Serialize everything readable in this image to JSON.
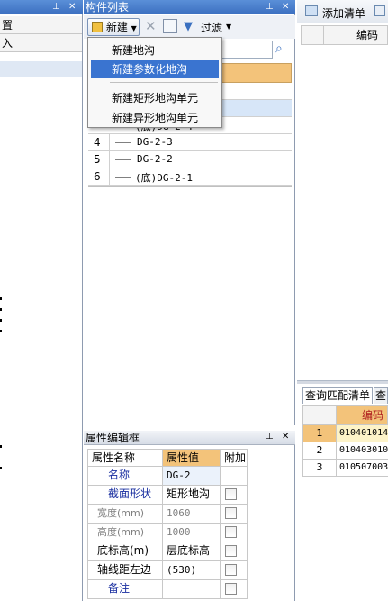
{
  "left_panel": {
    "item_1": "置",
    "item_2": "入"
  },
  "component_list": {
    "title": "构件列表",
    "new_button": "新建",
    "filter_button": "过滤",
    "rows": [
      {
        "num": "4",
        "name": "DG-2-3"
      },
      {
        "num": "5",
        "name": "DG-2-2"
      },
      {
        "num": "6",
        "name": "(底)DG-2-1"
      }
    ],
    "partial_row_name": "(底)DG-2-4"
  },
  "new_menu": {
    "items": [
      "新建地沟",
      "新建参数化地沟",
      "新建矩形地沟单元",
      "新建异形地沟单元"
    ],
    "highlighted_index": 1
  },
  "property_editor": {
    "title": "属性编辑框",
    "headers": {
      "name": "属性名称",
      "value": "属性值",
      "extra": "附加"
    },
    "rows": [
      {
        "name": "名称",
        "value": "DG-2",
        "style": "blue",
        "checkbox": false
      },
      {
        "name": "截面形状",
        "value": "矩形地沟",
        "style": "blue",
        "checkbox": true
      },
      {
        "name": "宽度(mm)",
        "value": "1060",
        "style": "gray",
        "checkbox": true
      },
      {
        "name": "高度(mm)",
        "value": "1000",
        "style": "gray",
        "checkbox": true
      },
      {
        "name": "底标高(m)",
        "value": "层底标高",
        "style": "black",
        "checkbox": true
      },
      {
        "name": "轴线距左边",
        "value": "(530)",
        "style": "black",
        "checkbox": true
      },
      {
        "name": "备注",
        "value": "",
        "style": "blue",
        "checkbox": true
      }
    ]
  },
  "bill_panel": {
    "add_button": "添加清单",
    "code_header": "编码",
    "tab_1": "查询匹配清单",
    "tab_2": "查",
    "match_code_header": "编码",
    "match_rows": [
      {
        "num": "1",
        "code": "010401014"
      },
      {
        "num": "2",
        "code": "010403010"
      },
      {
        "num": "3",
        "code": "010507003"
      }
    ]
  },
  "colors": {
    "title_blue": "#3b6fc0",
    "highlight": "#3a74d0",
    "header_orange": "#f3c37a",
    "selected_row": "#d7e6f8"
  }
}
